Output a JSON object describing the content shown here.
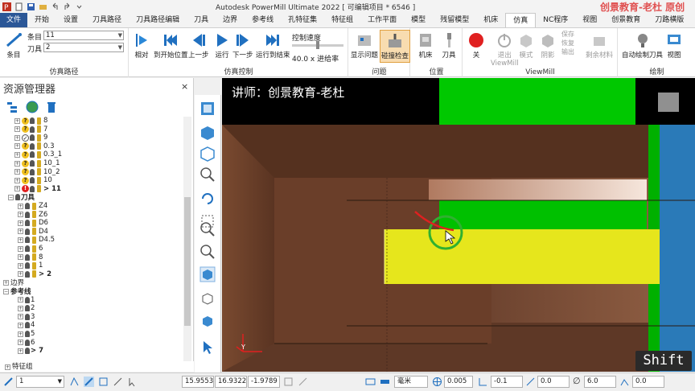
{
  "app": {
    "title": "Autodesk PowerMill Ultimate 2022  [ 可编辑项目 * 6546 ]",
    "watermark": "创景教育-老杜 原创"
  },
  "tabs": [
    "文件",
    "开始",
    "设置",
    "刀具路径",
    "刀具路径编辑",
    "刀具",
    "边界",
    "参考线",
    "孔特征集",
    "特征组",
    "工作平面",
    "模型",
    "残留模型",
    "机床",
    "仿真",
    "NC程序",
    "视图",
    "创景教育",
    "刀路横版"
  ],
  "active_tab": "仿真",
  "ribbon": {
    "path_group": {
      "label": "仿真路径",
      "item_label": "条目",
      "item_value": "11",
      "tool_label": "刀具",
      "tool_value": "2",
      "btn_item": "条目"
    },
    "control_group": {
      "label": "仿真控制",
      "relative": "相对",
      "to_start": "到开始位置",
      "prev": "上一步",
      "run": "运行",
      "next": "下一步",
      "run_end": "运行到结束",
      "speed_label": "控制速度",
      "feed_ratio": "40.0 x 进给率"
    },
    "issue_group": {
      "label": "问题",
      "show_issue": "显示问题",
      "collision": "碰撞检查"
    },
    "position_group": {
      "label": "位置",
      "machine": "机床",
      "tool": "刀具"
    },
    "viewmill_group": {
      "label": "ViewMill",
      "off": "关",
      "exit": "退出",
      "exit2": "ViewMill",
      "mode": "模式",
      "shade": "阴影",
      "save": "保存",
      "restore": "恢复",
      "output": "输出",
      "remaining": "剩余材料"
    },
    "draw_group": {
      "label": "绘制",
      "auto_draw": "自动绘制刀具",
      "view": "视图"
    }
  },
  "explorer": {
    "title": "资源管理器",
    "toolpaths": [
      {
        "name": "8",
        "status": "q"
      },
      {
        "name": "7",
        "status": "q"
      },
      {
        "name": "9",
        "status": "check"
      },
      {
        "name": "0.3",
        "status": "q"
      },
      {
        "name": "0.3_1",
        "status": "q"
      },
      {
        "name": "10_1",
        "status": "q"
      },
      {
        "name": "10_2",
        "status": "q"
      },
      {
        "name": "10",
        "status": "q"
      },
      {
        "name": "> 11",
        "status": "err"
      }
    ],
    "tools_label": "刀具",
    "tools": [
      "Z4",
      "Z6",
      "D6",
      "D4",
      "D4.5",
      "6",
      "8",
      "1",
      "> 2"
    ],
    "boundary_label": "边界",
    "refline_label": "参考线",
    "reflines": [
      "1",
      "2",
      "3",
      "4",
      "5",
      "6",
      "> 7"
    ],
    "feature_group_label": "特征组"
  },
  "viewport": {
    "teacher": "讲师：创景教育-老杜",
    "shift": "Shift",
    "axis_y": "Y",
    "colors": {
      "brown": "#6b3f2a",
      "green": "#00c800",
      "yellow": "#e8e820",
      "blue": "#2878b4"
    }
  },
  "status": {
    "layer": "1",
    "x": "15.9553",
    "y": "16.9322",
    "z": "-1.9789",
    "unit": "毫米",
    "tol": "0.005",
    "offset": "-0.1",
    "v1": "0.0",
    "diameter": "6.0",
    "v2": "0.0"
  }
}
